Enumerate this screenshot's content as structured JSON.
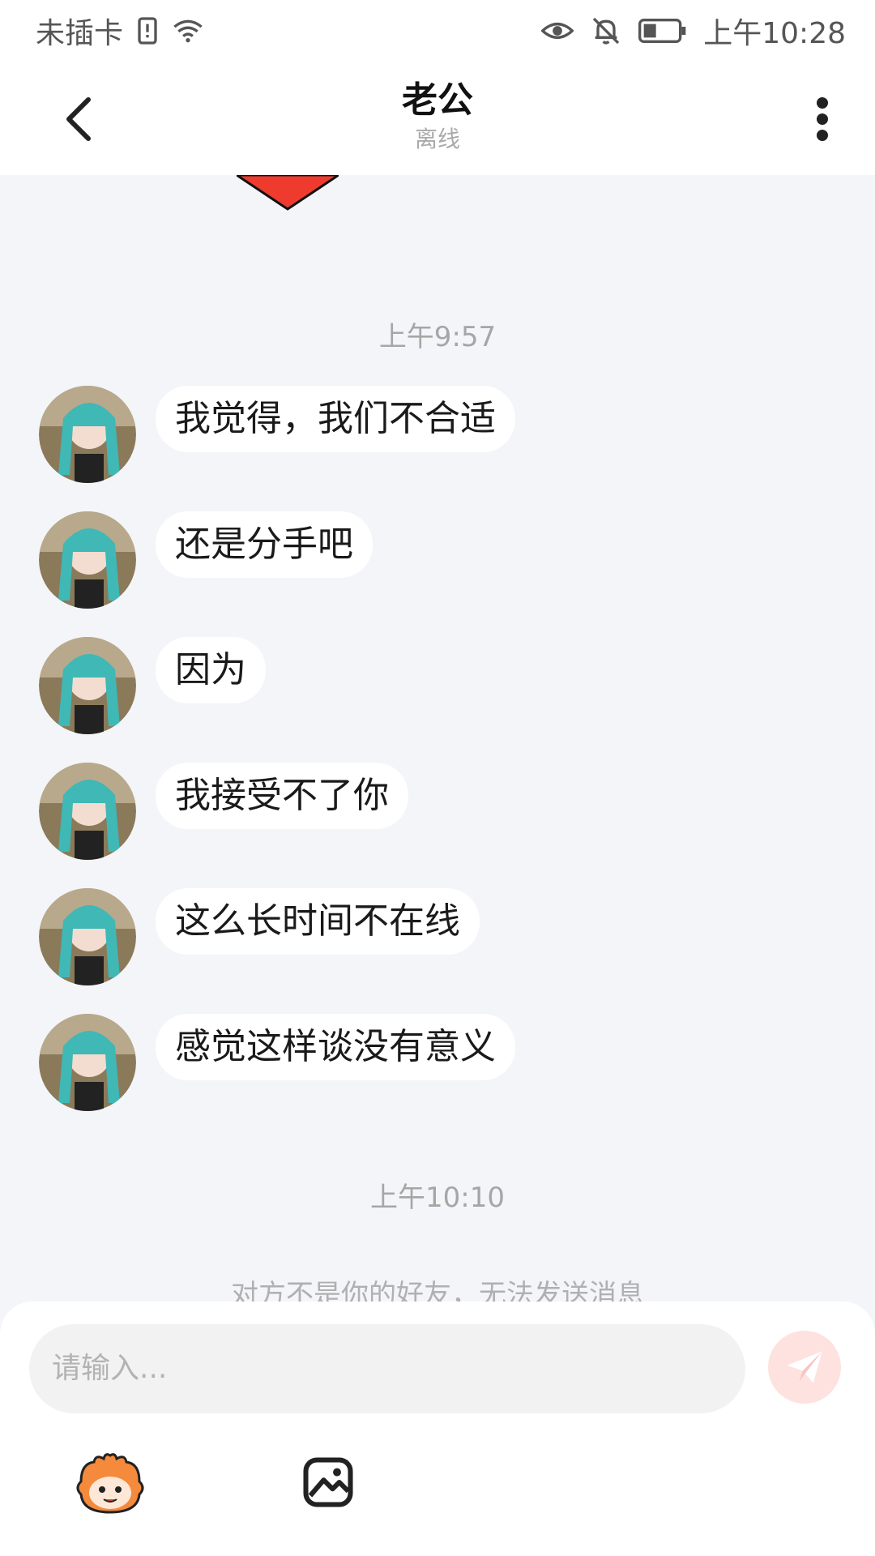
{
  "status_bar": {
    "carrier": "未插卡",
    "time": "上午10:28",
    "icons": [
      "sim-alert-icon",
      "wifi-icon",
      "eye-icon",
      "bell-off-icon",
      "battery-icon"
    ]
  },
  "header": {
    "title": "老公",
    "subtitle": "离线",
    "back_icon": "chevron-left-icon",
    "more_icon": "more-vertical-icon"
  },
  "chat": {
    "timestamps": [
      "上午9:57",
      "上午10:10"
    ],
    "messages": [
      {
        "text": "我觉得，我们不合适"
      },
      {
        "text": "还是分手吧"
      },
      {
        "text": "因为"
      },
      {
        "text": "我接受不了你"
      },
      {
        "text": "这么长时间不在线"
      },
      {
        "text": "感觉这样谈没有意义"
      }
    ],
    "notice": "对方不是你的好友，无法发送消息"
  },
  "composer": {
    "placeholder": "请输入...",
    "send_icon": "send-icon",
    "tools": [
      "mascot-sticker-icon",
      "image-icon"
    ]
  },
  "colors": {
    "accent_red": "#ee3b2e",
    "send_bg": "#fde2e0",
    "chat_bg": "#f4f5f8"
  }
}
